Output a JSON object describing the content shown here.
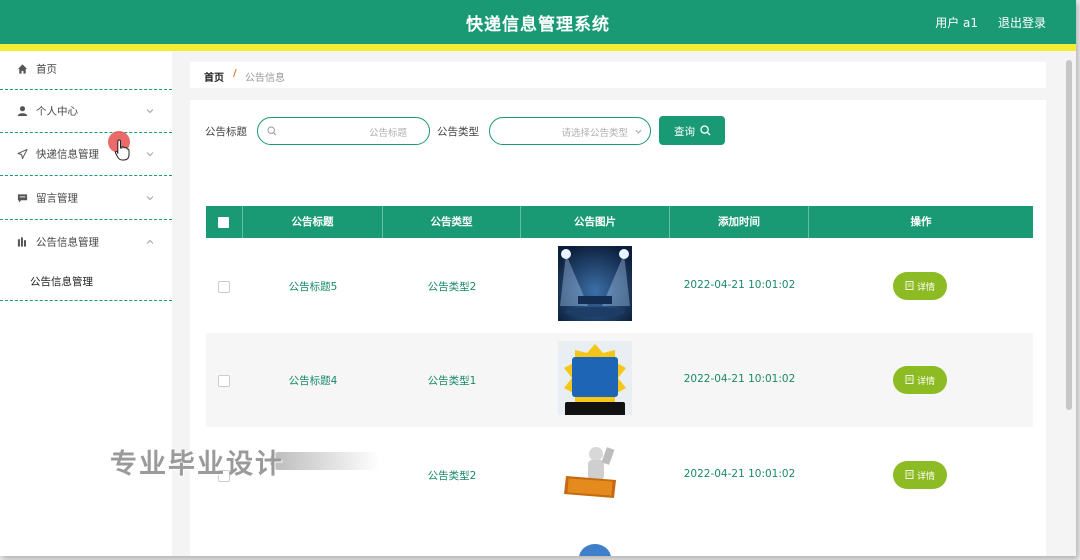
{
  "header": {
    "title": "快递信息管理系统",
    "user": "用户 a1",
    "logout": "退出登录"
  },
  "colors": {
    "primary": "#1a9a74",
    "accent_stripe": "#f3ec35",
    "detail_button": "#8dbb24"
  },
  "sidebar": {
    "items": [
      {
        "label": "首页",
        "icon": "home-icon"
      },
      {
        "label": "个人中心",
        "icon": "person-icon"
      },
      {
        "label": "快递信息管理",
        "icon": "send-icon"
      },
      {
        "label": "留言管理",
        "icon": "message-icon"
      },
      {
        "label": "公告信息管理",
        "icon": "chart-icon"
      }
    ],
    "sub_item": "公告信息管理"
  },
  "breadcrumb": {
    "home": "首页",
    "separator": "/",
    "current": "公告信息"
  },
  "search": {
    "title_label": "公告标题",
    "title_placeholder": "公告标题",
    "type_label": "公告类型",
    "type_placeholder": "请选择公告类型",
    "query_button": "查询"
  },
  "table": {
    "columns": [
      "公告标题",
      "公告类型",
      "公告图片",
      "添加时间",
      "操作"
    ],
    "rows": [
      {
        "title": "公告标题5",
        "type": "公告类型2",
        "image": "stage-spotlight-image",
        "time": "2022-04-21 10:01:02",
        "action": "详情"
      },
      {
        "title": "公告标题4",
        "type": "公告类型1",
        "image": "explosive-news-phone-image",
        "time": "2022-04-21 10:01:02",
        "action": "详情"
      },
      {
        "title": "",
        "type": "公告类型2",
        "image": "news-3d-figure-image",
        "time": "2022-04-21 10:01:02",
        "action": "详情"
      }
    ]
  },
  "watermark": "专业毕业设计"
}
